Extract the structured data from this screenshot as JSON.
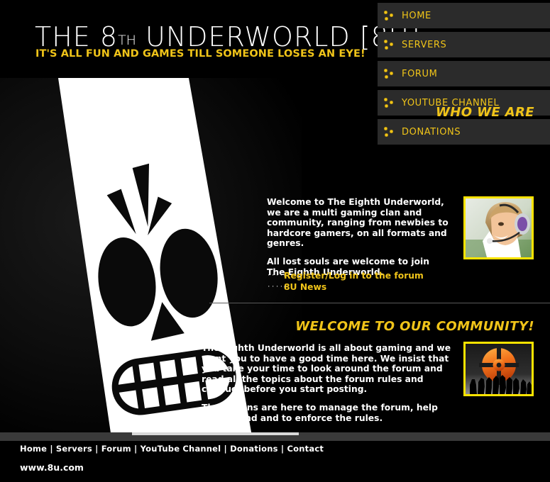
{
  "site": {
    "title_pre": "THE ",
    "title_num": "8",
    "title_th": "TH",
    "title_post": " UNDERWORLD [8U]",
    "tagline": "IT'S ALL FUN AND GAMES TILL SOMEONE LOSES AN EYE!",
    "accent_yellow": "#f0c419",
    "border_yellow": "#ffe400",
    "nav_bar_bg": "#2b2b2b",
    "page_bg": "#000000"
  },
  "nav": {
    "items": [
      {
        "label": "HOME",
        "icon": "three-dots-icon"
      },
      {
        "label": "SERVERS",
        "icon": "three-dots-icon"
      },
      {
        "label": "FORUM",
        "icon": "three-dots-icon"
      },
      {
        "label": "YOUTUBE CHANNEL",
        "icon": "three-dots-icon"
      },
      {
        "label": "DONATIONS",
        "icon": "three-dots-icon"
      }
    ]
  },
  "hero": {
    "image_alt": "skull-mask-graphic"
  },
  "who_we_are": {
    "heading": "WHO WE ARE",
    "paragraphs": [
      "Welcome to The Eighth Underworld, we are a multi gaming clan and community, ranging from newbies to hardcore gamers, on all formats and genres.",
      "All lost souls are welcome to join The Eighth Underworld."
    ],
    "links": [
      {
        "arrow": "····▸",
        "label": "Register/Log in to the forum"
      },
      {
        "arrow": "····▸",
        "label": "8U News"
      }
    ],
    "photo_alt": "woman-with-headset-photo"
  },
  "community": {
    "heading": "WELCOME TO OUR COMMUNITY!",
    "paragraphs": [
      "The Eighth Underworld is all about gaming and we want you to have a good time here. We insist that you take your time to look around the forum and read all the topics about the forum rules and conduct before you start posting.",
      "The admins are here to manage the forum, help you around and to enforce the rules."
    ],
    "photo_alt": "orange-crosshair-logo-with-crowd-silhouette"
  },
  "footer": {
    "links": [
      "Home",
      "Servers",
      "Forum",
      "YouTube Channel",
      "Donations",
      "Contact"
    ],
    "separator": " | ",
    "url": "www.8u.com"
  }
}
